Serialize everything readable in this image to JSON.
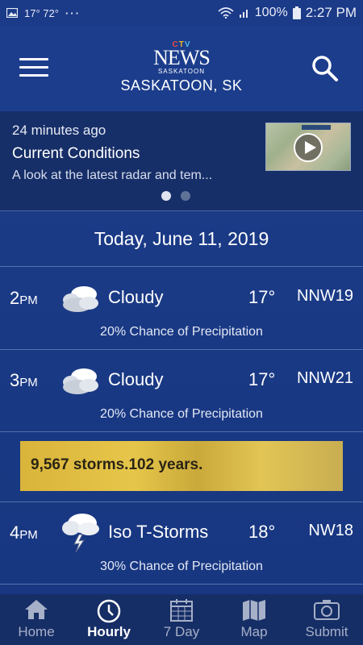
{
  "status_bar": {
    "weather": "17° 72°",
    "dots": "···",
    "battery": "100%",
    "time": "2:27 PM"
  },
  "header": {
    "logo_ctv": "CTV",
    "logo_news": "NEWS",
    "logo_city": "SASKATOON",
    "location": "SASKATOON, SK",
    "menu_icon": "hamburger-icon",
    "search_icon": "search-icon"
  },
  "news": {
    "time_ago": "24 minutes ago",
    "title": "Current Conditions",
    "description": "A look at the latest radar and tem...",
    "pager_count": 2,
    "pager_active": 0
  },
  "forecast": {
    "date": "Today, June 11, 2019",
    "hours": [
      {
        "hour": "2",
        "ampm": "PM",
        "condition": "Cloudy",
        "icon": "cloudy-icon",
        "temp": "17°",
        "wind": "NNW19",
        "precip": "20% Chance of Precipitation"
      },
      {
        "hour": "3",
        "ampm": "PM",
        "condition": "Cloudy",
        "icon": "cloudy-icon",
        "temp": "17°",
        "wind": "NNW21",
        "precip": "20% Chance of Precipitation"
      },
      {
        "hour": "4",
        "ampm": "PM",
        "condition": "Iso T-Storms",
        "icon": "thunderstorm-icon",
        "temp": "18°",
        "wind": "NW18",
        "precip": "30% Chance of Precipitation"
      }
    ]
  },
  "ad": {
    "text": "9,567 storms.102 years."
  },
  "bottom_nav": {
    "items": [
      {
        "label": "Home",
        "icon": "home-icon"
      },
      {
        "label": "Hourly",
        "icon": "clock-icon"
      },
      {
        "label": "7 Day",
        "icon": "calendar-icon"
      },
      {
        "label": "Map",
        "icon": "map-icon"
      },
      {
        "label": "Submit",
        "icon": "camera-icon"
      }
    ],
    "active": "Hourly"
  },
  "colors": {
    "background": "#1c3d8c",
    "card": "#172f68",
    "nav": "#162e66",
    "ad": "#e2c24a"
  }
}
